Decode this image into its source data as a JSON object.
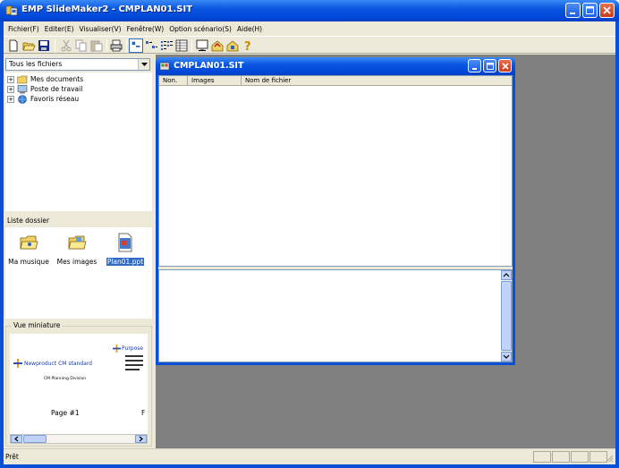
{
  "window": {
    "title": "EMP SlideMaker2 - CMPLAN01.SIT",
    "accent_color": "#0a4fd6"
  },
  "menu": [
    "Fichier(F)",
    "Editer(E)",
    "Visualiser(V)",
    "Fenêtre(W)",
    "Option scénario(S)",
    "Aide(H)"
  ],
  "toolbar": {
    "icons": [
      "new-icon",
      "open-icon",
      "save-icon",
      "cut-icon",
      "copy-icon",
      "paste-icon",
      "print-icon",
      "large-icons-view-icon",
      "small-icons-view-icon",
      "list-view-icon",
      "details-view-icon",
      "monitor-icon",
      "send-icon",
      "scenario-icon",
      "help-icon"
    ]
  },
  "left": {
    "dropdown_value": "Tous les fichiers",
    "tree": [
      {
        "label": "Mes documents",
        "icon": "folder-icon"
      },
      {
        "label": "Poste de travail",
        "icon": "computer-icon"
      },
      {
        "label": "Favoris réseau",
        "icon": "network-icon"
      }
    ],
    "folder_list_label": "Liste dossier",
    "folder_items": [
      {
        "label": "Ma musique",
        "icon": "music-folder-icon",
        "selected": false
      },
      {
        "label": "Mes images",
        "icon": "pictures-folder-icon",
        "selected": false
      },
      {
        "label": "Plan01.ppt",
        "icon": "ppt-file-icon",
        "selected": true
      }
    ],
    "thumbnail_label": "Vue miniature",
    "thumbnail": {
      "slide1_title": "Newproduct CM standard",
      "slide1_sub": "CM Planning Division",
      "slide1_page": "Page #1",
      "slide2_title": "Purpose",
      "slide2_page_partial": "F"
    }
  },
  "child_window": {
    "title": "CMPLAN01.SIT",
    "columns": [
      "Non.",
      "Images",
      "Nom de fichier"
    ]
  },
  "status": {
    "text": "Prêt"
  }
}
